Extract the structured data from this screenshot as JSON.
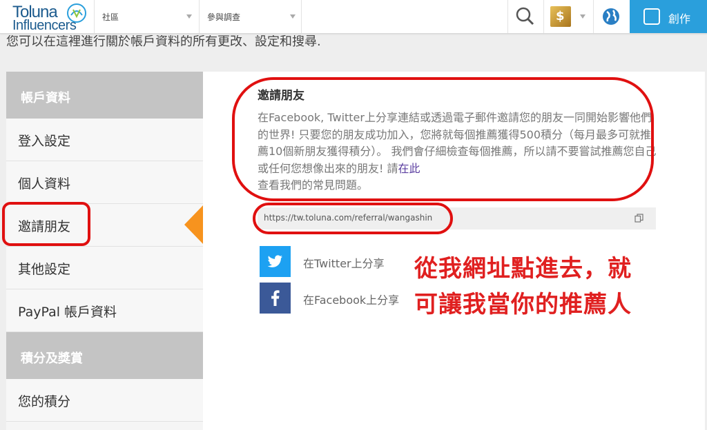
{
  "header": {
    "logo_top": "Toluna",
    "logo_bottom": "Influencers",
    "nav_community": "社區",
    "nav_surveys": "參與調查",
    "create_label": "創作",
    "avatar_glyph": "$"
  },
  "intro": "您可以在這裡進行關於帳戶資料的所有更改、設定和搜尋.",
  "sidebar": {
    "section_account": "帳戶資料",
    "items": [
      {
        "label": "登入設定"
      },
      {
        "label": "個人資料"
      },
      {
        "label": "邀請朋友"
      },
      {
        "label": "其他設定"
      },
      {
        "label": "PayPal 帳戶資料"
      }
    ],
    "section_points": "積分及獎賞",
    "points_item": "您的積分"
  },
  "invite": {
    "title": "邀請朋友",
    "description": "在Facebook, Twitter上分享連結或透過電子郵件邀請您的朋友一同開始影響他們的世界! 只要您的朋友成功加入，您將就每個推薦獲得500積分（每月最多可就推薦10個新朋友獲得積分）。 我們會仔細檢查每個推薦，所以請不要嘗試推薦您自己或任何您想像出來的朋友! 請",
    "link_text": "在此",
    "description_end": "查看我們的常見問題。",
    "referral_url": "https://tw.toluna.com/referral/wangashin",
    "twitter_label": "在Twitter上分享",
    "facebook_label": "在Facebook上分享"
  },
  "annotation": {
    "line1": "從我網址點進去，就",
    "line2": "可讓我當你的推薦人"
  },
  "colors": {
    "accent_blue": "#2a9fdc",
    "twitter": "#1da1f2",
    "facebook": "#3b5998",
    "active_arrow": "#f7931e",
    "annotation_red": "#e02020"
  }
}
